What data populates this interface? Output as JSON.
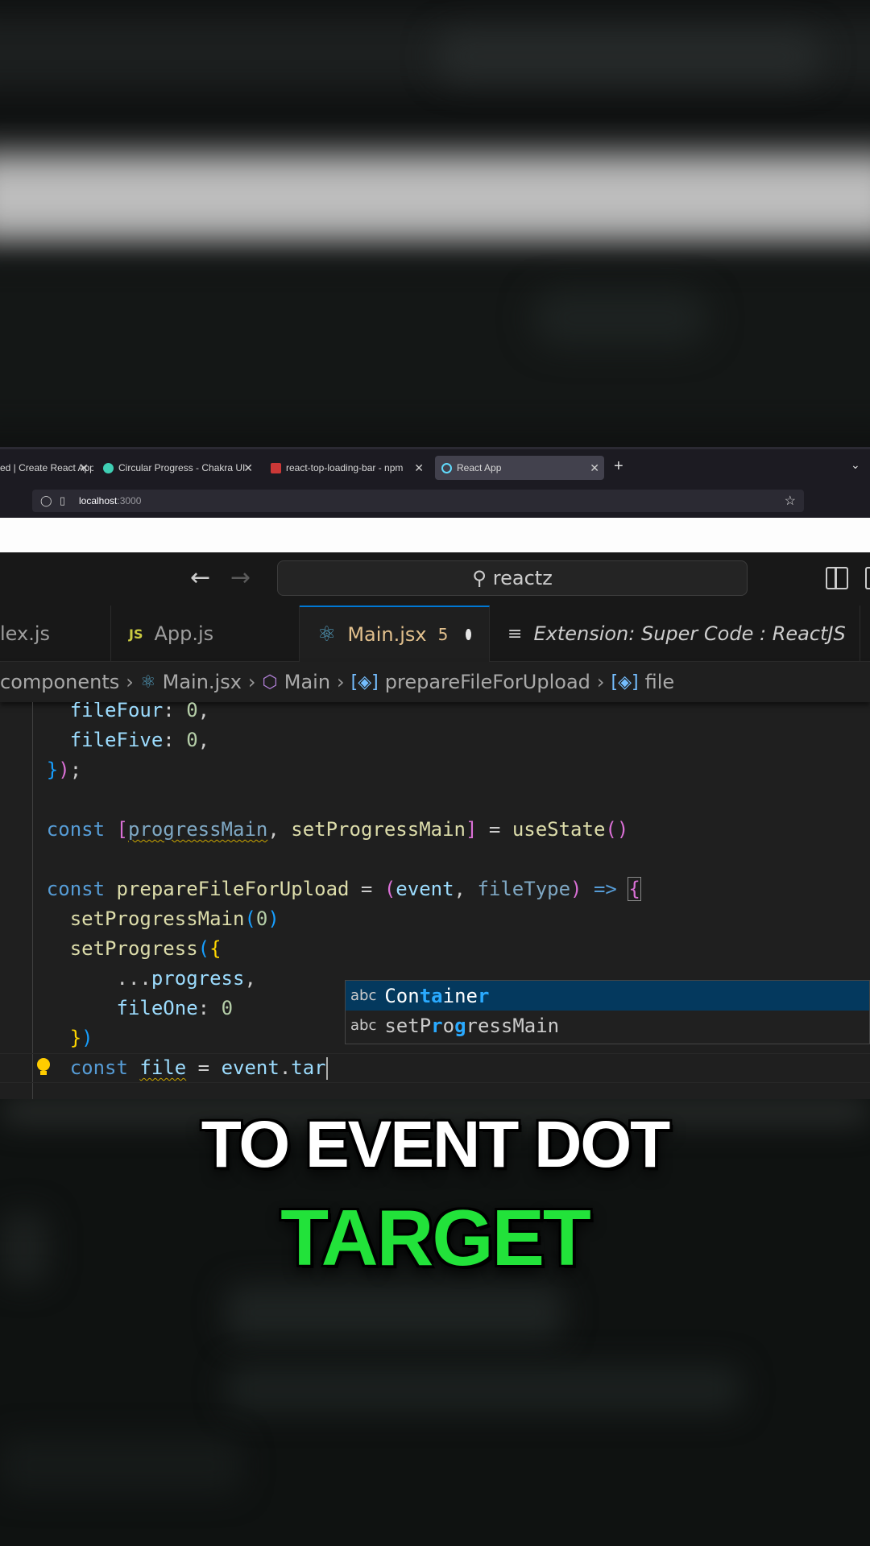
{
  "browser": {
    "tabs": [
      {
        "title": "ed | Create React App",
        "active": false
      },
      {
        "title": "Circular Progress - Chakra UI",
        "active": false
      },
      {
        "title": "react-top-loading-bar - npm",
        "active": false
      },
      {
        "title": "React App",
        "active": true
      }
    ],
    "url_host": "localhost",
    "url_port": ":3000"
  },
  "editor": {
    "search_text": "reactz",
    "tabs": [
      {
        "label": "lex.js"
      },
      {
        "label": "App.js",
        "badge": "JS"
      },
      {
        "label": "Main.jsx",
        "problems": "5",
        "active": true
      },
      {
        "label": "Extension: Super Code : ReactJS"
      }
    ],
    "breadcrumb": [
      "components",
      "Main.jsx",
      "Main",
      "prepareFileForUpload",
      "file"
    ],
    "suggestions": [
      {
        "pre": "Con",
        "hl1": "ta",
        "mid": "ine",
        "hl2": "r",
        "full": "Container",
        "selected": true
      },
      {
        "pre": "setP",
        "hl1": "r",
        "mid": "o",
        "hl2": "g",
        "rest": "ressMain",
        "full": "setProgressMain",
        "selected": false
      }
    ],
    "suggestion_kind": "abc"
  },
  "caption": {
    "line1": "TO EVENT DOT",
    "line2": "TARGET",
    "line2_color": "#22e23a"
  },
  "colors": {
    "accent": "#0078d4",
    "selection": "#04395e",
    "modified_tab": "#e2c08d"
  }
}
